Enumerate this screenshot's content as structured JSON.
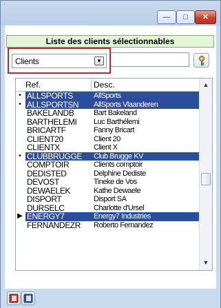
{
  "window": {
    "controls": {
      "minimize": "—",
      "maximize": "□",
      "close": "✕"
    }
  },
  "header": {
    "title": "Liste des clients sélectionnables"
  },
  "filter": {
    "selected": "Clients",
    "dropdown_glyph": "▼",
    "field_value": ""
  },
  "grid": {
    "columns": {
      "ref": "Ref.",
      "desc": "Desc."
    },
    "rows": [
      {
        "marker": "•",
        "ref": "ALLSPORTS",
        "desc": "AllSports",
        "selected": true
      },
      {
        "marker": "•",
        "ref": "ALLSPORTSN",
        "desc": "AllSports Vlaanderen",
        "selected": true
      },
      {
        "marker": "",
        "ref": "BAKELANDB",
        "desc": "Bart Bakeland",
        "selected": false
      },
      {
        "marker": "",
        "ref": "BARTHELEMI",
        "desc": "Luc Barthélemi",
        "selected": false
      },
      {
        "marker": "",
        "ref": "BRICARTF",
        "desc": "Fanny Bricart",
        "selected": false
      },
      {
        "marker": "",
        "ref": "CLIENT20",
        "desc": "Client 20",
        "selected": false
      },
      {
        "marker": "",
        "ref": "CLIENTX",
        "desc": "Client X",
        "selected": false
      },
      {
        "marker": "•",
        "ref": "CLUBBRUGGE",
        "desc": "Club Brugge KV",
        "selected": true
      },
      {
        "marker": "",
        "ref": "COMPTOIR",
        "desc": "Clients comptoir",
        "selected": false
      },
      {
        "marker": "",
        "ref": "DEDISTED",
        "desc": "Delphine Dediste",
        "selected": false
      },
      {
        "marker": "",
        "ref": "DEVOST",
        "desc": "Tineke de Vos",
        "selected": false
      },
      {
        "marker": "",
        "ref": "DEWAELEK",
        "desc": "Kathe Dewaele",
        "selected": false
      },
      {
        "marker": "",
        "ref": "DISPORT",
        "desc": "Disport SA",
        "selected": false
      },
      {
        "marker": "",
        "ref": "DURSELC",
        "desc": "Charlotte d'Ursel",
        "selected": false
      },
      {
        "marker": "▶",
        "ref": "ENERGY7",
        "desc": "Energy7 Industries",
        "selected": true
      },
      {
        "marker": "",
        "ref": "FERNANDEZR",
        "desc": "Roberto Fernandez",
        "selected": false
      }
    ],
    "scroll_up": "▲",
    "scroll_down": "▼"
  },
  "icons": {
    "key_button": "key-icon",
    "bottom_left": "notebook-red-icon",
    "bottom_right": "notebook-blue-icon"
  },
  "colors": {
    "selection": "#2c4c9e",
    "header_bg": "#e4f4d9",
    "highlight_border": "#c8222c",
    "window_bg": "#c9dcef"
  }
}
